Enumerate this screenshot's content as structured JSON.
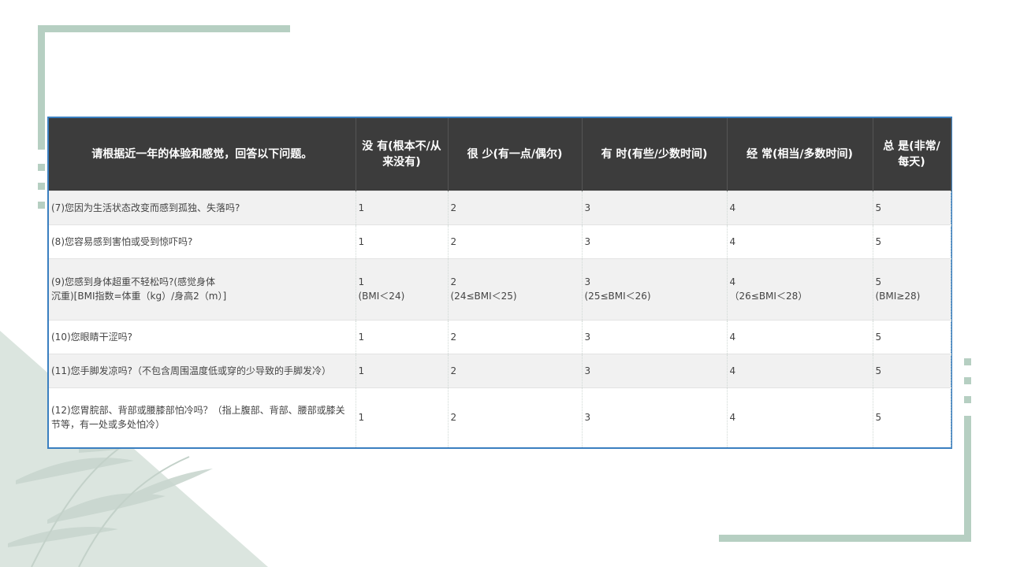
{
  "table": {
    "headers": [
      "请根据近一年的体验和感觉，回答以下问题。",
      "没  有(根本不/从来没有)",
      "很  少(有一点/偶尔)",
      "有  时(有些/少数时间)",
      "经  常(相当/多数时间)",
      "总  是(非常/每天)"
    ],
    "rows": [
      [
        "(7)您因为生活状态改变而感到孤独、失落吗?",
        "1",
        "2",
        "3",
        "4",
        "5"
      ],
      [
        "(8)您容易感到害怕或受到惊吓吗?",
        "1",
        "2",
        "3",
        "4",
        "5"
      ],
      [
        "(9)您感到身体超重不轻松吗?(感觉身体\n沉重)[BMI指数=体重（kg）/身高2（m）]",
        "1\n(BMI＜24)",
        "2\n(24≤BMI＜25)",
        "3\n(25≤BMI＜26)",
        "4\n（26≤BMI＜28）",
        "5\n(BMI≥28)"
      ],
      [
        "(10)您眼睛干涩吗?",
        "1",
        "2",
        "3",
        "4",
        "5"
      ],
      [
        "(11)您手脚发凉吗?（不包含周围温度低或穿的少导致的手脚发冷）",
        "1",
        "2",
        "3",
        "4",
        "5"
      ],
      [
        "(12)您胃脘部、背部或腰膝部怕冷吗？（指上腹部、背部、腰部或膝关节等，有一处或多处怕冷）",
        "1",
        "2",
        "3",
        "4",
        "5"
      ]
    ]
  },
  "colors": {
    "header_bg": "#3c3c3c",
    "border": "#3a7fc0",
    "decor": "#b6cfc2"
  }
}
